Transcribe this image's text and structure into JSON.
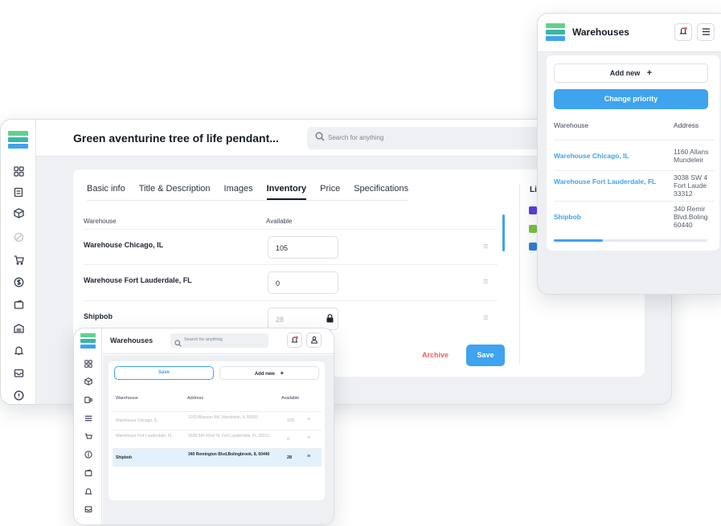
{
  "main": {
    "title": "Green aventurine tree of life pendant...",
    "search_placeholder": "Search for anything",
    "tabs": [
      "Basic info",
      "Title & Description",
      "Images",
      "Inventory",
      "Price",
      "Specifications"
    ],
    "active_tab": "Inventory",
    "columns": {
      "warehouse": "Warehouse",
      "available": "Available"
    },
    "rows": [
      {
        "name": "Warehouse Chicago, IL",
        "qty": "105",
        "locked": false
      },
      {
        "name": "Warehouse Fort Lauderdale, FL",
        "qty": "0",
        "locked": false
      },
      {
        "name": "Shipbob",
        "qty": "28",
        "locked": true
      }
    ],
    "archive_label": "Archive",
    "save_label": "Save",
    "side_label": "Li",
    "accent": "#3fa3ee"
  },
  "right_panel": {
    "title": "Warehouses",
    "add_new_label": "Add new",
    "change_priority_label": "Change priority",
    "columns": {
      "warehouse": "Warehouse",
      "address": "Address"
    },
    "rows": [
      {
        "name": "Warehouse Chicago, IL",
        "address": [
          "1160 Allans",
          "Mundeleir"
        ]
      },
      {
        "name": "Warehouse Fort Lauderdale, FL",
        "address": [
          "3038 SW 4",
          "Fort Laude",
          "33312"
        ]
      },
      {
        "name": "Shipbob",
        "address": [
          "340 Remir",
          "Blvd.Boling",
          "60440"
        ]
      }
    ],
    "scroll_progress": 0.32
  },
  "small_window": {
    "title": "Warehouses",
    "search_placeholder": "Search for anything",
    "save_label": "Save",
    "add_new_label": "Add new",
    "columns": {
      "warehouse": "Warehouse",
      "address": "Address",
      "available": "Available"
    },
    "rows": [
      {
        "name": "Warehouse Chicago, IL",
        "address": "1160 Allanson Rd, Mundelein, IL 60060",
        "available": "105",
        "highlighted": false
      },
      {
        "name": "Warehouse Fort Lauderdale, FL",
        "address": "3038 SW 42nd St, Fort Lauderdale, FL 33312",
        "available": "0",
        "highlighted": false
      },
      {
        "name": "Shipbob",
        "address": "340 Remington Blvd,Bolingbrook, IL 60440",
        "available": "28",
        "highlighted": true
      }
    ]
  }
}
